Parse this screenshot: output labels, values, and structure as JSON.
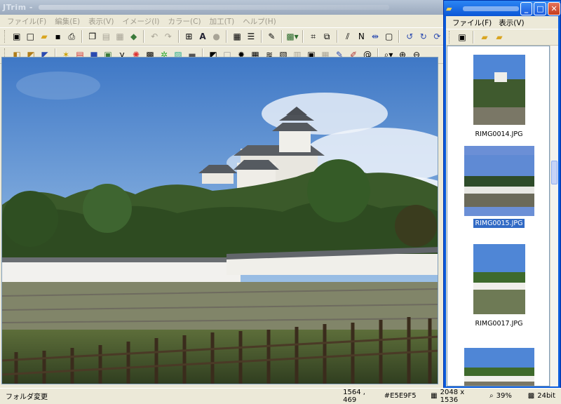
{
  "app": {
    "title": "JTrim"
  },
  "menu": [
    "ファイル(F)",
    "編集(E)",
    "表示(V)",
    "イメージ(I)",
    "カラー(C)",
    "加工(T)",
    "ヘルプ(H)"
  ],
  "toolbar1": [
    "capture-icon",
    "new-icon",
    "open-icon",
    "save-icon",
    "print-icon",
    "copy-icon",
    "paste-icon",
    "paste-new-icon",
    "undo-icon",
    "redo-icon",
    "fit-icon",
    "text-icon",
    "circle-icon",
    "grid-icon",
    "strip-icon",
    "eyedropper-icon",
    "color-menu-icon",
    "crop-icon",
    "resize-icon",
    "skew-icon",
    "flip-h-icon",
    "flip-v-icon",
    "frame-icon",
    "rotate-left-icon",
    "rotate-90-icon",
    "rotate-right-icon"
  ],
  "browser": {
    "menu": [
      "ファイル(F)",
      "表示(V)"
    ],
    "thumbnails": [
      {
        "name": "RIMG0014.JPG",
        "selected": false
      },
      {
        "name": "RIMG0015.JPG",
        "selected": true
      },
      {
        "name": "RIMG0017.JPG",
        "selected": false
      },
      {
        "name": "",
        "selected": false
      }
    ]
  },
  "status": {
    "message": "フォルダ変更",
    "coords": "1564 , 469",
    "color": "#E5E9F5",
    "size": "2048 x 1536",
    "zoom": "39%",
    "depth": "24bit"
  }
}
